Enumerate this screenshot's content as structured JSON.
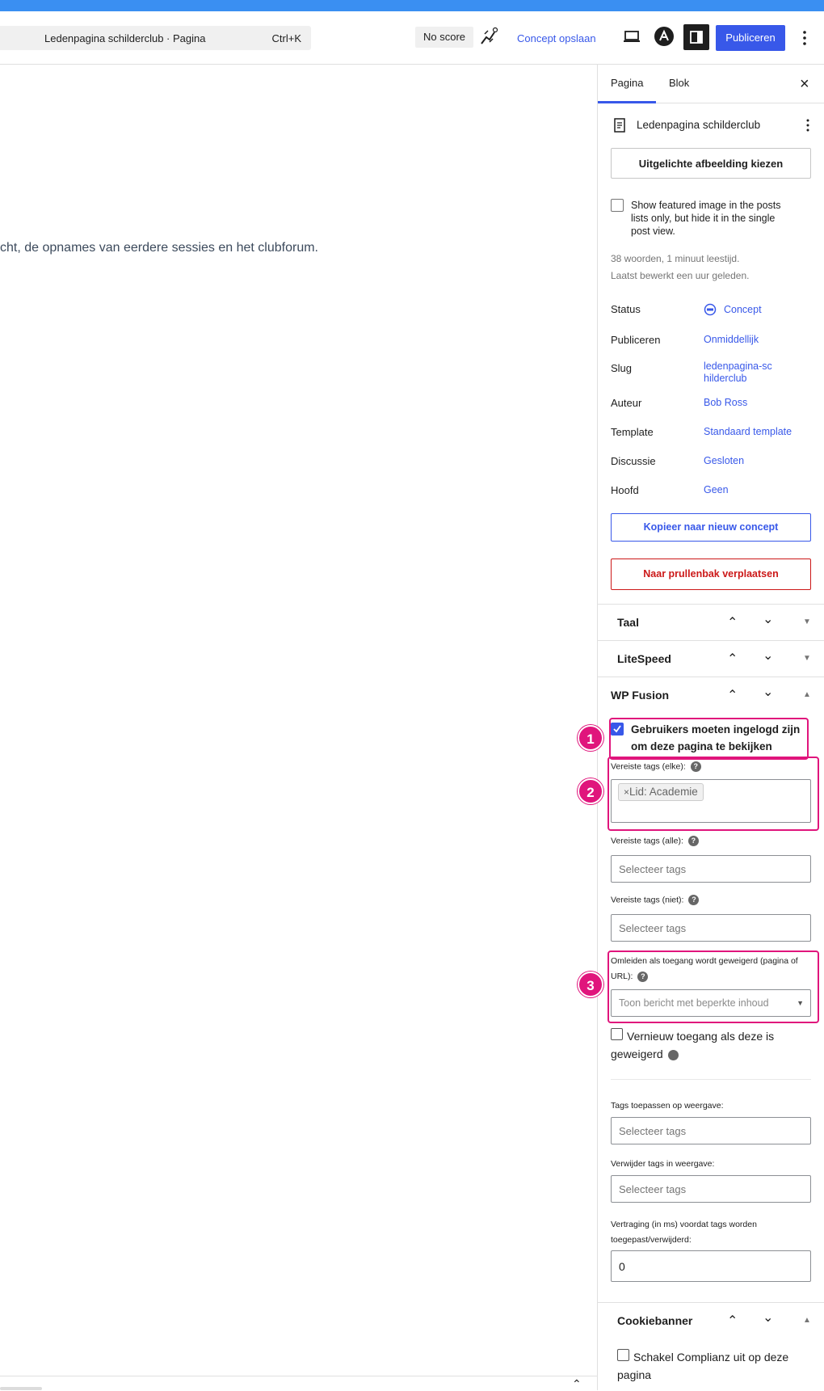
{
  "header": {
    "command_title": "Ledenpagina schilderclub · Pagina",
    "command_shortcut": "Ctrl+K",
    "score_label": "No score",
    "save_draft_label": "Concept opslaan",
    "publish_label": "Publiceren"
  },
  "editor": {
    "body_text": "cht, de opnames van eerdere sessies en het clubforum."
  },
  "sidebar": {
    "tabs": [
      "Pagina",
      "Blok"
    ],
    "page_title": "Ledenpagina schilderclub",
    "featured_image_button": "Uitgelichte afbeelding kiezen",
    "featured_image_checkbox": "Show featured image in the posts lists only, but hide it in the single post view.",
    "words_info": "38 woorden, 1 minuut leestijd.",
    "last_edited": "Laatst bewerkt een uur geleden.",
    "rows": [
      {
        "label": "Status",
        "value": "Concept"
      },
      {
        "label": "Publiceren",
        "value": "Onmiddellijk"
      },
      {
        "label": "Slug",
        "value": "ledenpagina-schilderclub"
      },
      {
        "label": "Auteur",
        "value": "Bob Ross"
      },
      {
        "label": "Template",
        "value": "Standaard template"
      },
      {
        "label": "Discussie",
        "value": "Gesloten"
      },
      {
        "label": "Hoofd",
        "value": "Geen"
      }
    ],
    "copy_button": "Kopieer naar nieuw concept",
    "trash_button": "Naar prullenbak verplaatsen",
    "panels": {
      "taal": "Taal",
      "litespeed": "LiteSpeed",
      "wpfusion": "WP Fusion",
      "cookiebanner": "Cookiebanner"
    },
    "wpfusion": {
      "login_required": "Gebruikers moeten ingelogd zijn om deze pagina te bekijken",
      "tags_any_label": "Vereiste tags (elke):",
      "tag_chip": "Lid: Academie",
      "tag_chip_remove": "×",
      "tags_all_label": "Vereiste tags (alle):",
      "tags_all_placeholder": "Selecteer tags",
      "tags_not_label": "Vereiste tags (niet):",
      "tags_not_placeholder": "Selecteer tags",
      "redirect_label": "Omleiden als toegang wordt geweigerd (pagina of URL):",
      "redirect_placeholder": "Toon bericht met beperkte inhoud",
      "renew_label": "Vernieuw toegang als deze is geweigerd",
      "apply_tags_label": "Tags toepassen op weergave:",
      "apply_tags_placeholder": "Selecteer tags",
      "remove_tags_label": "Verwijder tags in weergave:",
      "remove_tags_placeholder": "Selecteer tags",
      "delay_label": "Vertraging (in ms) voordat tags worden toegepast/verwijderd:",
      "delay_value": "0"
    },
    "cookiebanner": {
      "disable_label": "Schakel Complianz uit op deze pagina"
    }
  },
  "annotations": [
    "1",
    "2",
    "3"
  ],
  "colors": {
    "accent": "#3858e9",
    "highlight": "#e0157c",
    "danger": "#cc1818",
    "topbar": "#3a8ff2"
  }
}
